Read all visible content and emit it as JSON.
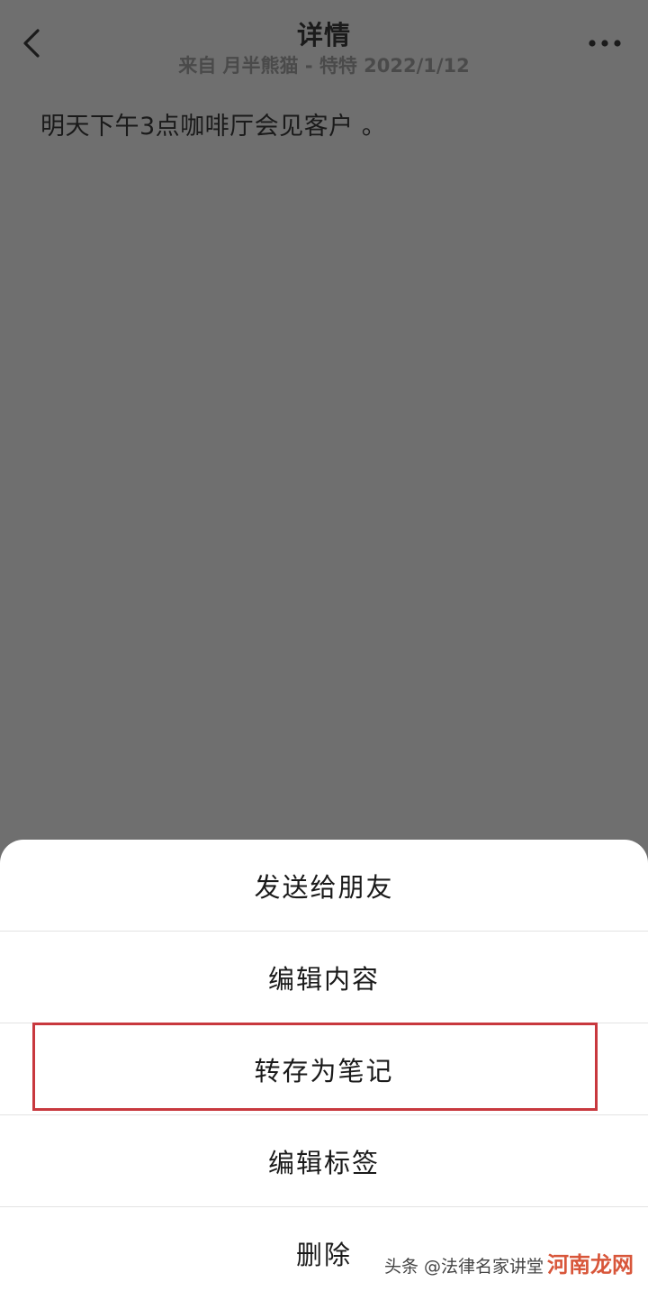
{
  "header": {
    "title": "详情",
    "subtitle": "来自 月半熊猫 - 特特 2022/1/12",
    "back_icon": "chevron-left-icon",
    "more_icon": "more-horizontal-icon"
  },
  "note": {
    "content": "明天下午3点咖啡厅会见客户 。"
  },
  "action_sheet": {
    "items": [
      {
        "label": "发送给朋友"
      },
      {
        "label": "编辑内容"
      },
      {
        "label": "转存为笔记"
      },
      {
        "label": "编辑标签"
      },
      {
        "label": "删除"
      }
    ],
    "highlight_color": "#c8383e"
  },
  "watermark": {
    "text": "头条 @法律名家讲堂",
    "brand": "河南龙网"
  }
}
